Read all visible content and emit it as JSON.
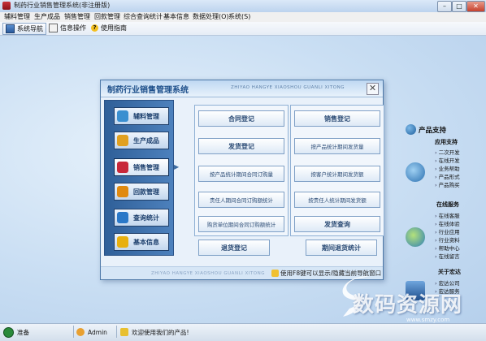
{
  "window": {
    "title": "制药行业销售管理系统(非注册版)",
    "controls": [
      "–",
      "□",
      "✕"
    ]
  },
  "menu": [
    "辅料管理",
    "生产成品",
    "销售管理",
    "回款管理",
    "综合查询统计",
    "基本信息",
    "数据处理(O)",
    "系统(S)"
  ],
  "toolbar": {
    "items": [
      {
        "label": "系统导航",
        "icon": "monitor-icon"
      },
      {
        "label": "信息操作",
        "icon": "info-icon"
      },
      {
        "label": "使用指南",
        "icon": "help-icon"
      }
    ]
  },
  "dialog": {
    "title": "制药行业销售管理系统",
    "pinyin": "ZHIYAO HANGYE XIAOSHOU GUANLI XITONG",
    "close": "✕",
    "nav": [
      {
        "label": "辅料管理",
        "icon": "materials-icon",
        "color": "#3a8fd0"
      },
      {
        "label": "生产成品",
        "icon": "products-icon",
        "color": "#e0a020"
      },
      {
        "label": "销售管理",
        "icon": "sales-icon",
        "color": "#c8283a"
      },
      {
        "label": "回款管理",
        "icon": "payment-icon",
        "color": "#e08a10"
      },
      {
        "label": "查询统计",
        "icon": "stats-icon",
        "color": "#2a78c8"
      },
      {
        "label": "基本信息",
        "icon": "star-icon",
        "color": "#e8b010"
      }
    ],
    "left_group": [
      "合同登记",
      "发货登记",
      "按产品统计期间合同订购量",
      "责任人期间合同订购额统计",
      "购货单位期间合同订购额统计"
    ],
    "right_group": [
      "销售登记",
      "按产品统计期间发货量",
      "按客户统计期间发货额",
      "按责任人统计期间发货额",
      "发货查询"
    ],
    "bottom_left": "退货登记",
    "bottom_right": "期间退货统计",
    "footer_tip": "使用F8键可以显示/隐藏当前导航窗口"
  },
  "support": {
    "heading": "产品支持",
    "sections": [
      {
        "title": "应用支持",
        "links": [
          "二次开发",
          "在线开发",
          "业务帮助",
          "产品形式",
          "产品购买"
        ]
      },
      {
        "title": "在线服务",
        "links": [
          "在线客服",
          "在线体验",
          "行业应用",
          "行业资料",
          "帮助中心",
          "在线留言"
        ]
      },
      {
        "title": "关于宏达",
        "links": [
          "宏达公司",
          "宏达服务"
        ]
      }
    ]
  },
  "status": {
    "state": "准备",
    "user": "Admin",
    "welcome": "欢迎使用我们的产品!"
  },
  "watermark": {
    "text": "数码资源网",
    "url": "www.smzy.com"
  },
  "colors": {
    "accent": "#1d4f8a",
    "workspace": "#bcd6f0",
    "nav_panel": "#3d6fae"
  }
}
